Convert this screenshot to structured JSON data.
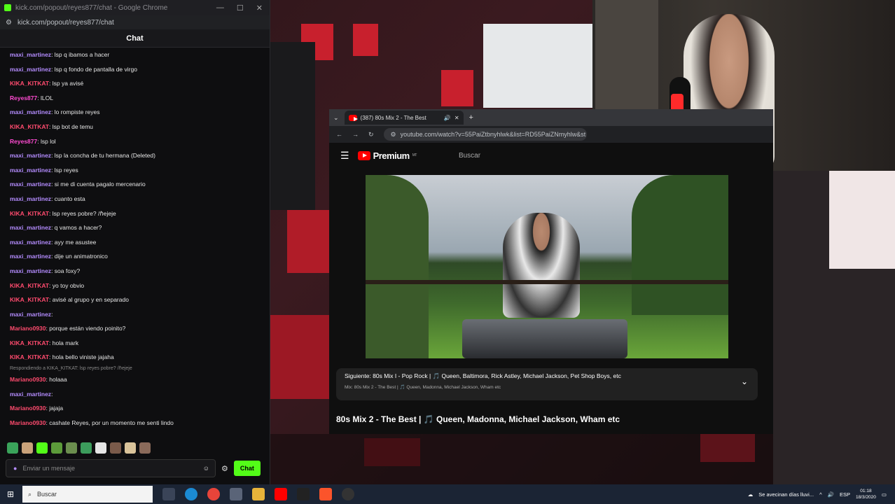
{
  "chat": {
    "window_title": "kick.com/popout/reyes877/chat - Google Chrome",
    "url": "kick.com/popout/reyes877/chat",
    "header": "Chat",
    "messages": [
      {
        "user": "maxi_martinez",
        "sep": ": ",
        "text": "lsp q ibamos a hacer",
        "color": "#b48cff"
      },
      {
        "user": "maxi_martinez",
        "sep": ": ",
        "text": "lsp q fondo de pantalla de virgo",
        "color": "#b48cff"
      },
      {
        "user": "KIKA_KITKAT",
        "sep": ": ",
        "text": "lsp ya avisé",
        "color": "#ff4b6e"
      },
      {
        "user": "Reyes877",
        "sep": ": ",
        "text": "lLOL",
        "color": "#ff4bd2"
      },
      {
        "user": "maxi_martinez",
        "sep": ": ",
        "text": "lo rompiste reyes",
        "color": "#b48cff"
      },
      {
        "user": "KIKA_KITKAT",
        "sep": ": ",
        "text": "lsp bot de temu",
        "color": "#ff4b6e"
      },
      {
        "user": "Reyes877",
        "sep": ": ",
        "text": "lsp lol",
        "color": "#ff4bd2"
      },
      {
        "user": "maxi_martinez",
        "sep": ": ",
        "text": "lsp la concha de tu hermana (Deleted)",
        "color": "#b48cff"
      },
      {
        "user": "maxi_martinez",
        "sep": ": ",
        "text": "lsp reyes",
        "color": "#b48cff"
      },
      {
        "user": "maxi_martinez",
        "sep": ": ",
        "text": "si me di cuenta pagalo mercenario",
        "color": "#b48cff"
      },
      {
        "user": "maxi_martinez",
        "sep": ": ",
        "text": "cuanto esta",
        "color": "#b48cff"
      },
      {
        "user": "KIKA_KITKAT",
        "sep": ": ",
        "text": "lsp reyes pobre? /ℏejeje",
        "color": "#ff4b6e"
      },
      {
        "user": "maxi_martinez",
        "sep": ": ",
        "text": "q vamos a hacer?",
        "color": "#b48cff"
      },
      {
        "user": "maxi_martinez",
        "sep": ": ",
        "text": "ayy me asustee",
        "color": "#b48cff"
      },
      {
        "user": "maxi_martinez",
        "sep": ": ",
        "text": "dije un animatronico",
        "color": "#b48cff"
      },
      {
        "user": "maxi_martinez",
        "sep": ": ",
        "text": "soa foxy?",
        "color": "#b48cff"
      },
      {
        "user": "KIKA_KITKAT",
        "sep": ": ",
        "text": "yo toy obvio",
        "color": "#ff4b6e"
      },
      {
        "user": "KIKA_KITKAT",
        "sep": ": ",
        "text": "avisé al grupo y en separado",
        "color": "#ff4b6e"
      },
      {
        "user": "maxi_martinez",
        "sep": ": ",
        "text": "",
        "color": "#b48cff"
      },
      {
        "user": "Mariano0930",
        "sep": ": ",
        "text": "porque están viendo poinito?",
        "color": "#ff4b6e"
      },
      {
        "user": "KIKA_KITKAT",
        "sep": ": ",
        "text": "hola mark",
        "color": "#ff4b6e"
      },
      {
        "user": "KIKA_KITKAT",
        "sep": ": ",
        "text": "hola bello viniste jajaha",
        "color": "#ff4b6e"
      }
    ],
    "reply_note": "Respondiendo a KIKA_KITKAT: lsp reyes pobre? /ℏejeje",
    "messages_after": [
      {
        "user": "Mariano0930",
        "sep": ": ",
        "text": "holaaa",
        "color": "#ff4b6e"
      },
      {
        "user": "maxi_martinez",
        "sep": ": ",
        "text": "",
        "color": "#b48cff"
      },
      {
        "user": "Mariano0930",
        "sep": ": ",
        "text": "jajaja",
        "color": "#ff4b6e"
      },
      {
        "user": "Mariano0930",
        "sep": ": ",
        "text": "cashate Reyes, por un momento me senti lindo",
        "color": "#ff4b6e"
      }
    ],
    "input_placeholder": "Enviar un mensaje",
    "send_label": "Chat"
  },
  "youtube": {
    "tab_title": "(387) 80s Mix 2 - The Best",
    "url": "youtube.com/watch?v=55PaiZtbnyhlwk&list=RD55PaiZNmyhlw&st",
    "logo_text": "Premium",
    "logo_sup": "MT",
    "search_placeholder": "Buscar",
    "next_label": "Siguiente: 80s Mix I - Pop Rock | 🎵 Queen, Baltimora, Rick Astley, Michael Jackson, Pet Shop Boys, etc",
    "mix_label": "Mix: 80s Mix 2 - The Best | 🎵 Queen, Madonna, Michael Jackson, Wham etc",
    "video_title": "80s Mix 2 - The Best | 🎵 Queen, Madonna, Michael Jackson, Wham etc"
  },
  "taskbar": {
    "search_placeholder": "Buscar",
    "weather": "Se avecinan días lluvi...",
    "lang": "ESP",
    "time": "01:18",
    "date": "18/3/2020"
  }
}
